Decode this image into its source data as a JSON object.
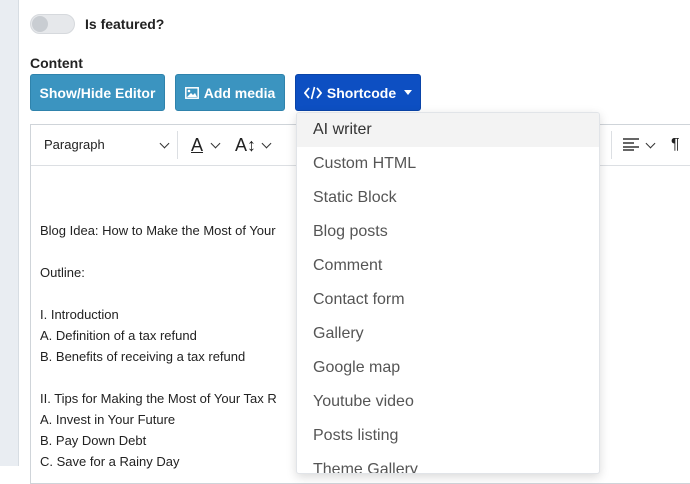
{
  "featured": {
    "label": "Is featured?",
    "enabled": false
  },
  "content": {
    "label": "Content",
    "buttons": {
      "editor": "Show/Hide Editor",
      "media": "Add media",
      "shortcode": "Shortcode"
    }
  },
  "toolbar": {
    "format": "Paragraph",
    "text_color": "A",
    "font_size": "A↕"
  },
  "editor_lines": [
    "Blog Idea: How to Make the Most of Your",
    "",
    "Outline:",
    "",
    "I. Introduction",
    "A. Definition of a tax refund",
    "B. Benefits of receiving a tax refund",
    "",
    "II. Tips for Making the Most of Your Tax R",
    "A. Invest in Your Future",
    "B. Pay Down Debt",
    "C. Save for a Rainy Day"
  ],
  "shortcode_menu": {
    "items": [
      "AI writer",
      "Custom HTML",
      "Static Block",
      "Blog posts",
      "Comment",
      "Contact form",
      "Gallery",
      "Google map",
      "Youtube video",
      "Posts listing",
      "Theme Gallery"
    ],
    "active_index": 0
  },
  "colors": {
    "primary": "#3b94c0",
    "shortcode": "#0d4fc2"
  }
}
